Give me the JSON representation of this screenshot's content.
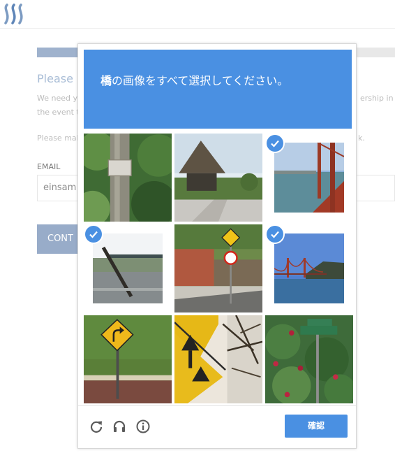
{
  "page": {
    "title_partial": "Please p",
    "body_line1_left": "We need yo",
    "body_line1_right": "ership in",
    "body_line2": "the event t",
    "body_line3_left": "Please mak",
    "body_line3_right": "k.",
    "email_label": "EMAIL",
    "email_value": "einsam",
    "continue_button_partial": "CONT",
    "progress_fraction": 0.12,
    "colors": {
      "progress_fill": "#9fb2cd",
      "logo": "#6f8fb8"
    }
  },
  "captcha": {
    "prompt_bold": "橋",
    "prompt_rest": "の画像をすべて選択してください。",
    "verify_label": "確認",
    "accent_color": "#4a90e2",
    "tiles": [
      {
        "subject": "tree-trunk-with-sign",
        "selected": false
      },
      {
        "subject": "thatched-hut",
        "selected": false
      },
      {
        "subject": "golden-gate-bridge-deck",
        "selected": true
      },
      {
        "subject": "bridge-over-river",
        "selected": true
      },
      {
        "subject": "road-signs-street",
        "selected": false
      },
      {
        "subject": "golden-gate-bridge-distant",
        "selected": true
      },
      {
        "subject": "curve-road-sign-field",
        "selected": false
      },
      {
        "subject": "road-sign-closeup",
        "selected": false
      },
      {
        "subject": "street-sign-flowers",
        "selected": false
      }
    ],
    "footer_icons": [
      "reload-icon",
      "audio-icon",
      "info-icon"
    ]
  }
}
